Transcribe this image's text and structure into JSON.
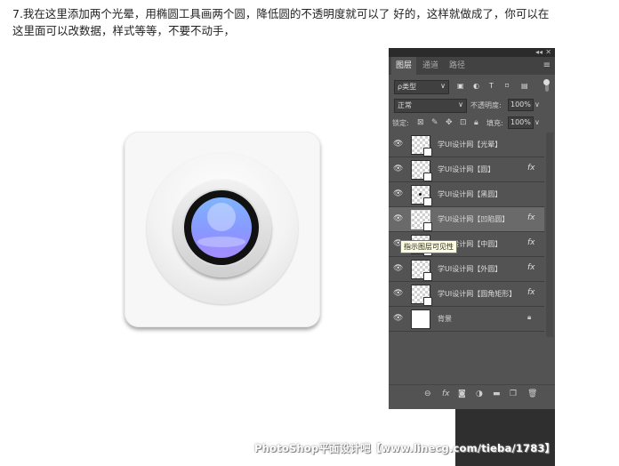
{
  "instruction": {
    "line1": "7.我在这里添加两个光晕，用椭圆工具画两个圆，降低圆的不透明度就可以了 好的，这样就做成了，你可以在",
    "line2": "这里面可以改数据，样式等等，不要不动手，"
  },
  "panel": {
    "tabs": [
      {
        "label": "图层",
        "active": true
      },
      {
        "label": "通道",
        "active": false
      },
      {
        "label": "路径",
        "active": false
      }
    ],
    "filter": {
      "label": "ρ类型",
      "dropdown": "∨"
    },
    "blend_mode": {
      "label": "正常",
      "dropdown": "∨"
    },
    "opacity": {
      "label": "不透明度:",
      "value": "100%"
    },
    "lock": {
      "label": "锁定:"
    },
    "fill": {
      "label": "填充:",
      "value": "100%"
    },
    "tooltip": "指示图层可见性",
    "layers": [
      {
        "name": "学UI设计网【光晕】",
        "fx": false,
        "selected": false,
        "thumb": "transparent"
      },
      {
        "name": "学UI设计网【圆】",
        "fx": true,
        "selected": false,
        "thumb": "transparent"
      },
      {
        "name": "学UI设计网【黑圆】",
        "fx": false,
        "selected": false,
        "thumb": "dot"
      },
      {
        "name": "学UI设计网【凹陷圆】",
        "fx": true,
        "selected": true,
        "thumb": "transparent"
      },
      {
        "name": "学UI设计网【中圆】",
        "fx": true,
        "selected": false,
        "thumb": "transparent"
      },
      {
        "name": "学UI设计网【外圆】",
        "fx": true,
        "selected": false,
        "thumb": "transparent"
      },
      {
        "name": "学UI设计网【圆角矩形】",
        "fx": true,
        "selected": false,
        "thumb": "transparent"
      },
      {
        "name": "背景",
        "fx": false,
        "selected": false,
        "thumb": "white",
        "locked": true
      }
    ],
    "fx_label": "fx",
    "bottom_icons": [
      "link-icon",
      "fx-icon",
      "mask-icon",
      "adjustment-icon",
      "group-icon",
      "new-layer-icon",
      "delete-icon"
    ]
  },
  "watermark": "PhotoShop平面设计吧【www.linecg.com/tieba/1783】"
}
